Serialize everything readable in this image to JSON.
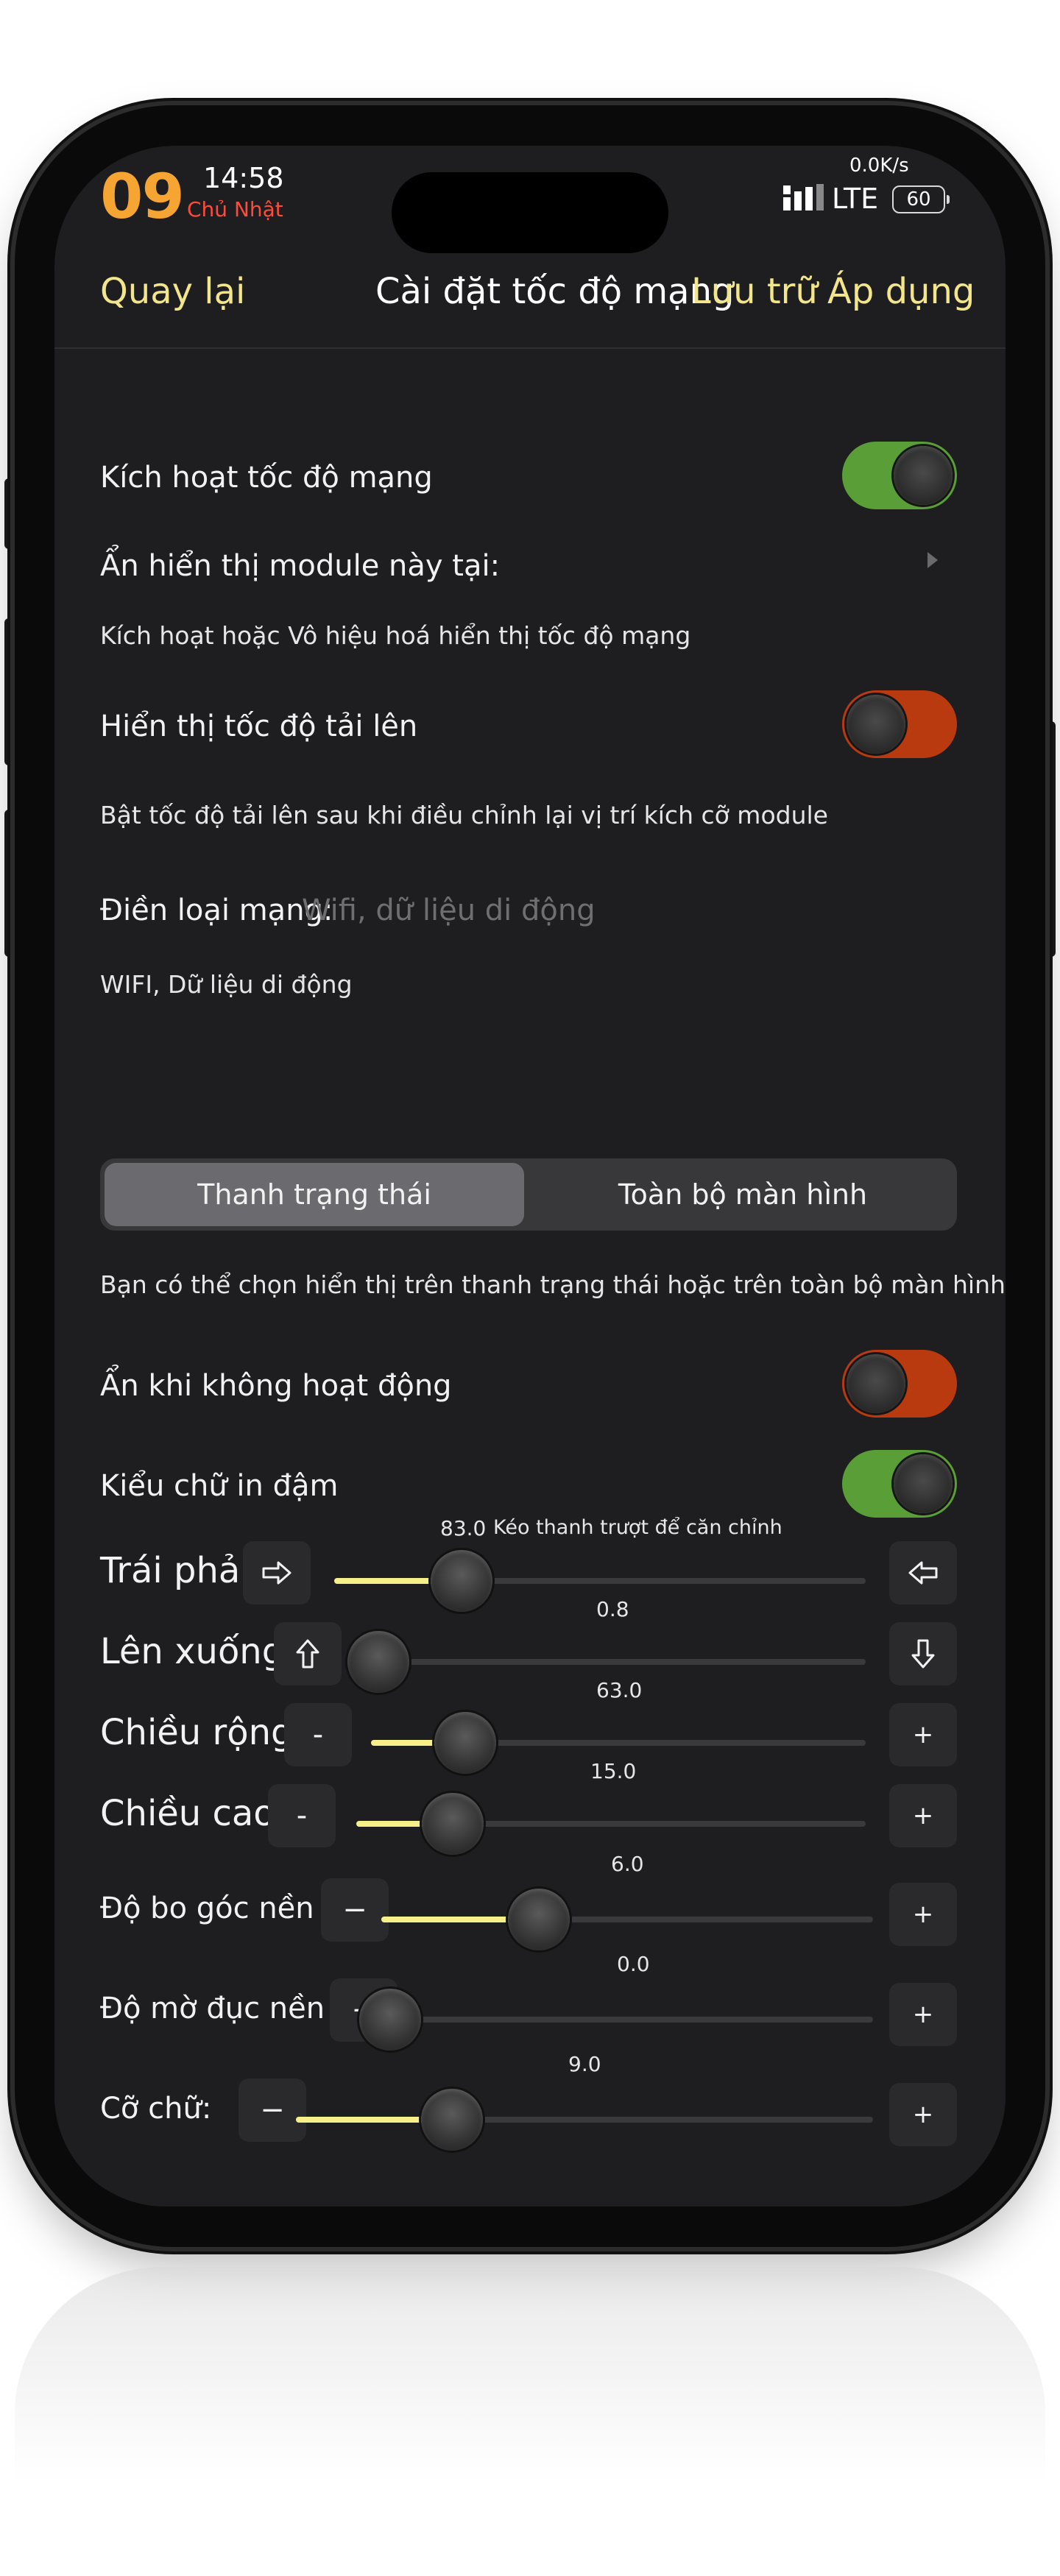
{
  "status_bar": {
    "day": "09",
    "time": "14:58",
    "weekday": "Chủ Nhật",
    "net_speed": "0.0K/s",
    "network": "LTE",
    "battery": "60"
  },
  "nav": {
    "back": "Quay lại",
    "title": "Cài đặt tốc độ mạng",
    "save": "Lưu trữ",
    "apply": "Áp dụng"
  },
  "enable_speed": {
    "label": "Kích hoạt tốc độ mạng",
    "on": true,
    "color": "#5a9e37"
  },
  "hide_module": {
    "label": "Ẩn hiển thị module này tại:",
    "note": "Kích hoạt hoặc Vô hiệu hoá hiển thị tốc độ mạng"
  },
  "upload_speed": {
    "label": "Hiển thị tốc độ tải lên",
    "on": false,
    "color": "#b93a0f",
    "note": "Bật tốc độ tải lên sau khi điều chỉnh lại vị trí kích cỡ module"
  },
  "network_type": {
    "label": "Điền loại mạng:",
    "placeholder": "Wifi, dữ liệu di động",
    "note": "WIFI, Dữ liệu di động"
  },
  "display_mode": {
    "options": [
      "Thanh trạng thái",
      "Toàn bộ màn hình"
    ],
    "selected": "Thanh trạng thái",
    "note": "Bạn có thể chọn hiển thị trên thanh trạng thái hoặc trên toàn bộ màn hình"
  },
  "hide_inactive": {
    "label": "Ẩn khi không hoạt động",
    "on": false,
    "color": "#b93a0f"
  },
  "bold_font": {
    "label": "Kiểu chữ in đậm",
    "on": true,
    "color": "#5a9e37"
  },
  "sliders": {
    "left_right": {
      "label": "Trái phải",
      "value": "83.0",
      "hint": "Kéo thanh trượt để căn chỉnh",
      "fill_fraction": 0.24
    },
    "up_down": {
      "label": "Lên xuống",
      "value": "0.8",
      "fill_fraction": 0.0
    },
    "width": {
      "label": "Chiều rộng",
      "value": "63.0",
      "dec": "-",
      "inc": "+",
      "fill_fraction": 0.19
    },
    "height": {
      "label": "Chiều cao",
      "value": "15.0",
      "dec": "-",
      "inc": "+",
      "fill_fraction": 0.19
    },
    "corner": {
      "label": "Độ bo góc nền",
      "value": "6.0",
      "dec": "−",
      "inc": "+",
      "fill_fraction": 0.32
    },
    "opacity": {
      "label": "Độ mờ đục nền",
      "value": "0.0",
      "dec": "−",
      "inc": "+",
      "fill_fraction": 0.0
    },
    "font_size": {
      "label": "Cỡ chữ:",
      "value": "9.0",
      "dec": "−",
      "inc": "+",
      "fill_fraction": 0.27
    }
  }
}
